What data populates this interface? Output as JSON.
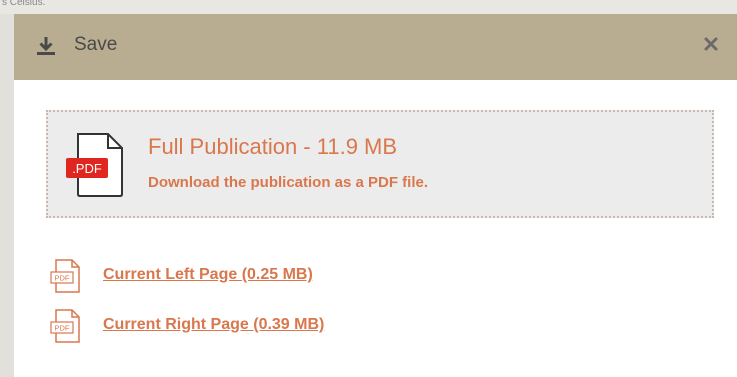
{
  "background": {
    "snippet": "s Celsius."
  },
  "dialog": {
    "title": "Save",
    "header_icon": "download-icon",
    "close_icon": "close-icon",
    "close_label": "✕"
  },
  "full_publication": {
    "icon": "pdf-file-icon",
    "icon_badge": ".PDF",
    "title": "Full Publication - 11.9 MB",
    "description": "Download the publication as a PDF file."
  },
  "page_links": [
    {
      "icon": "pdf-file-icon",
      "icon_badge": "PDF",
      "label": "Current Left Page (0.25 MB)"
    },
    {
      "icon": "pdf-file-icon",
      "icon_badge": "PDF",
      "label": "Current Right Page (0.39 MB)"
    }
  ],
  "colors": {
    "header_bg": "#b9ad91",
    "accent": "#d9774d",
    "pdf_badge": "#e0271f",
    "card_bg": "#ececec"
  }
}
